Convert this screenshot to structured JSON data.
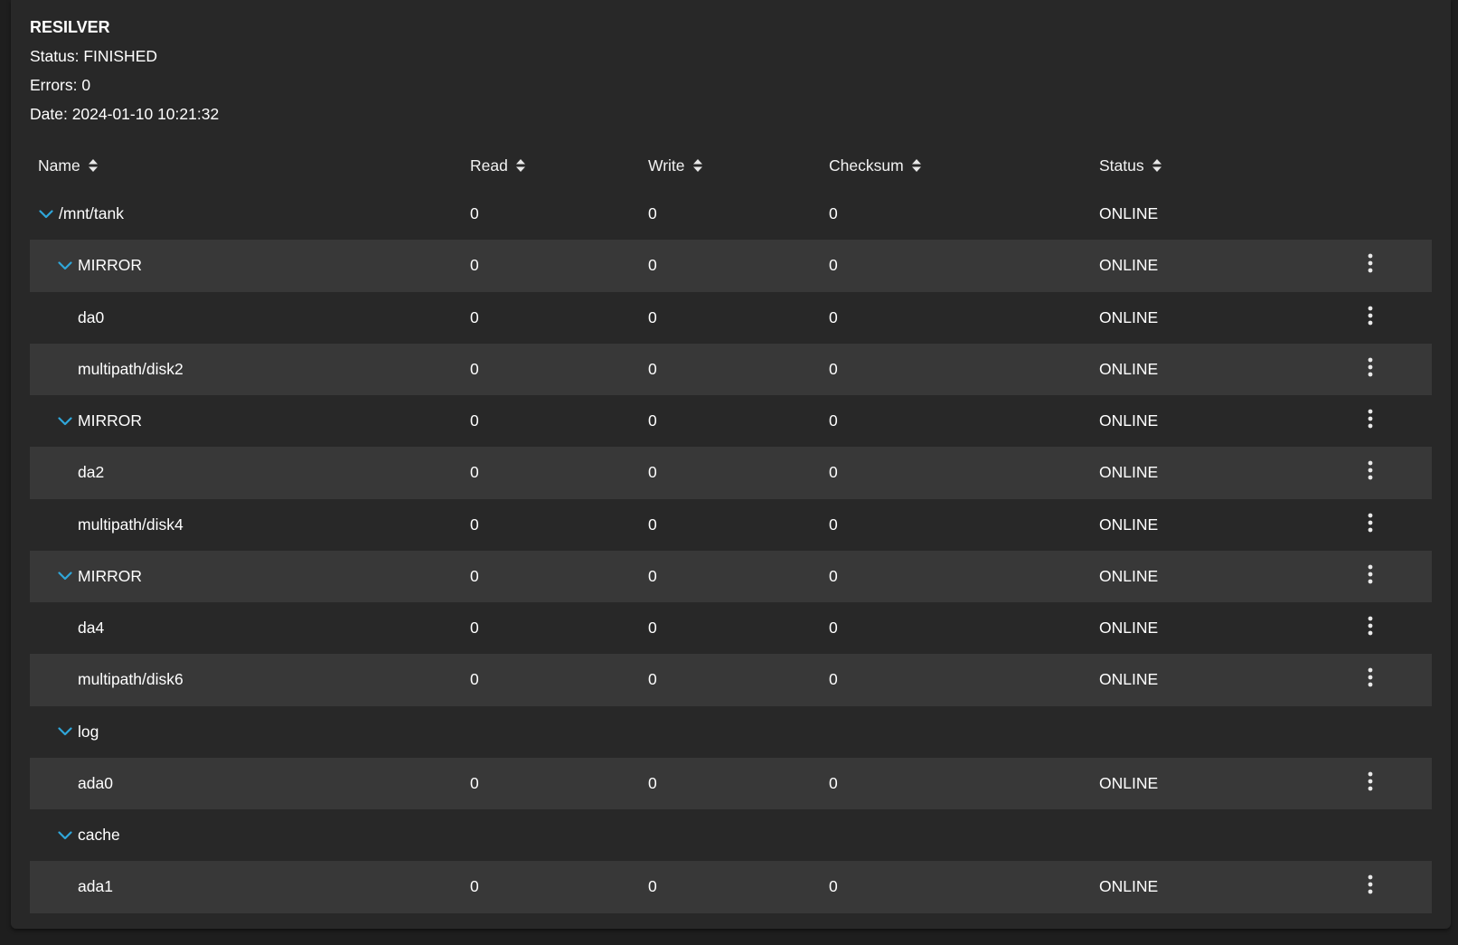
{
  "summary": {
    "title": "RESILVER",
    "status": "Status: FINISHED",
    "errors": "Errors: 0",
    "date": "Date: 2024-01-10 10:21:32"
  },
  "columns": {
    "name": "Name",
    "read": "Read",
    "write": "Write",
    "checksum": "Checksum",
    "status": "Status"
  },
  "rows": [
    {
      "name": "/mnt/tank",
      "read": "0",
      "write": "0",
      "checksum": "0",
      "status": "ONLINE",
      "level": 0,
      "expanded": true,
      "menu": false
    },
    {
      "name": "MIRROR",
      "read": "0",
      "write": "0",
      "checksum": "0",
      "status": "ONLINE",
      "level": 1,
      "expanded": true,
      "menu": true
    },
    {
      "name": "da0",
      "read": "0",
      "write": "0",
      "checksum": "0",
      "status": "ONLINE",
      "level": 2,
      "expanded": false,
      "menu": true
    },
    {
      "name": "multipath/disk2",
      "read": "0",
      "write": "0",
      "checksum": "0",
      "status": "ONLINE",
      "level": 2,
      "expanded": false,
      "menu": true
    },
    {
      "name": "MIRROR",
      "read": "0",
      "write": "0",
      "checksum": "0",
      "status": "ONLINE",
      "level": 1,
      "expanded": true,
      "menu": true
    },
    {
      "name": "da2",
      "read": "0",
      "write": "0",
      "checksum": "0",
      "status": "ONLINE",
      "level": 2,
      "expanded": false,
      "menu": true
    },
    {
      "name": "multipath/disk4",
      "read": "0",
      "write": "0",
      "checksum": "0",
      "status": "ONLINE",
      "level": 2,
      "expanded": false,
      "menu": true
    },
    {
      "name": "MIRROR",
      "read": "0",
      "write": "0",
      "checksum": "0",
      "status": "ONLINE",
      "level": 1,
      "expanded": true,
      "menu": true
    },
    {
      "name": "da4",
      "read": "0",
      "write": "0",
      "checksum": "0",
      "status": "ONLINE",
      "level": 2,
      "expanded": false,
      "menu": true
    },
    {
      "name": "multipath/disk6",
      "read": "0",
      "write": "0",
      "checksum": "0",
      "status": "ONLINE",
      "level": 2,
      "expanded": false,
      "menu": true
    },
    {
      "name": "log",
      "read": "",
      "write": "",
      "checksum": "",
      "status": "",
      "level": 1,
      "expanded": true,
      "menu": false
    },
    {
      "name": "ada0",
      "read": "0",
      "write": "0",
      "checksum": "0",
      "status": "ONLINE",
      "level": 2,
      "expanded": false,
      "menu": true
    },
    {
      "name": "cache",
      "read": "",
      "write": "",
      "checksum": "",
      "status": "",
      "level": 1,
      "expanded": true,
      "menu": false
    },
    {
      "name": "ada1",
      "read": "0",
      "write": "0",
      "checksum": "0",
      "status": "ONLINE",
      "level": 2,
      "expanded": false,
      "menu": true
    }
  ],
  "icons": {
    "sort": "sort-icon",
    "expand": "chevron-down-icon",
    "menu": "more-vert-icon"
  },
  "colors": {
    "accent": "#2fa6d9",
    "background": "#1e1e1e",
    "card": "#282828",
    "row_alt": "#383838"
  }
}
